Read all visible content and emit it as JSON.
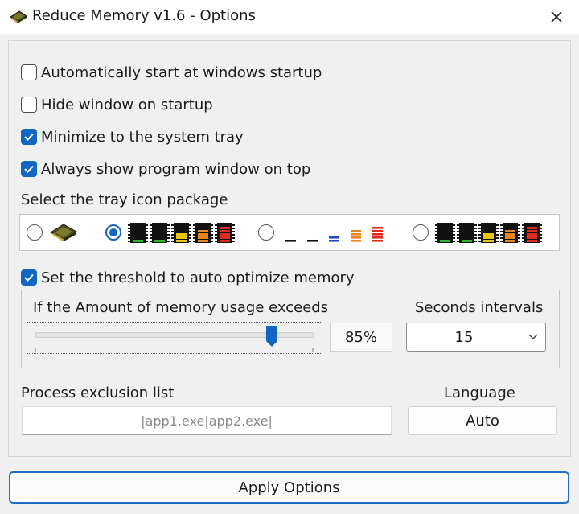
{
  "window": {
    "title": "Reduce Memory v1.6 - Options",
    "app_icon": "memory-chip-icon",
    "close_icon": "close-icon"
  },
  "options": [
    {
      "label": "Automatically start at windows startup",
      "checked": false
    },
    {
      "label": "Hide window on startup",
      "checked": false
    },
    {
      "label": "Minimize to the system tray",
      "checked": true
    },
    {
      "label": "Always show program window on top",
      "checked": true
    }
  ],
  "tray": {
    "label": "Select the tray icon package",
    "selected_index": 1,
    "packages": [
      {
        "icons": [
          "memory-chip-icon"
        ]
      },
      {
        "icons": [
          "memory-bars-dark-green-icon",
          "memory-bars-dark-green-icon",
          "memory-bars-dark-yellow-icon",
          "memory-bars-dark-orange-icon",
          "memory-bars-dark-red-icon"
        ]
      },
      {
        "icons": [
          "memory-bars-light-black-icon",
          "memory-bars-light-black-icon",
          "memory-bars-light-blue-icon",
          "memory-bars-light-orange-icon",
          "memory-bars-light-red-icon"
        ]
      },
      {
        "icons": [
          "memory-bars-dark-green-icon",
          "memory-bars-dark-green-icon",
          "memory-bars-dark-yellow-icon",
          "memory-bars-dark-orange-icon",
          "memory-bars-dark-red-icon"
        ]
      }
    ]
  },
  "threshold": {
    "label": "Set the threshold to auto optimize memory",
    "checked": true,
    "usage_label": "If the Amount of memory usage exceeds",
    "percent": 85,
    "percent_text": "85%",
    "interval_label": "Seconds intervals",
    "interval_value": "15"
  },
  "exclusion": {
    "label": "Process exclusion list",
    "value": "|app1.exe|app2.exe|"
  },
  "language": {
    "label": "Language",
    "value": "Auto"
  },
  "apply_label": "Apply Options",
  "colors": {
    "accent": "#1166c4",
    "apply_border": "#1f6fc4",
    "green": "#2fb82f",
    "yellow": "#e7c71a",
    "orange": "#e8861c",
    "red": "#e02a1e",
    "blue": "#2a46c8"
  }
}
